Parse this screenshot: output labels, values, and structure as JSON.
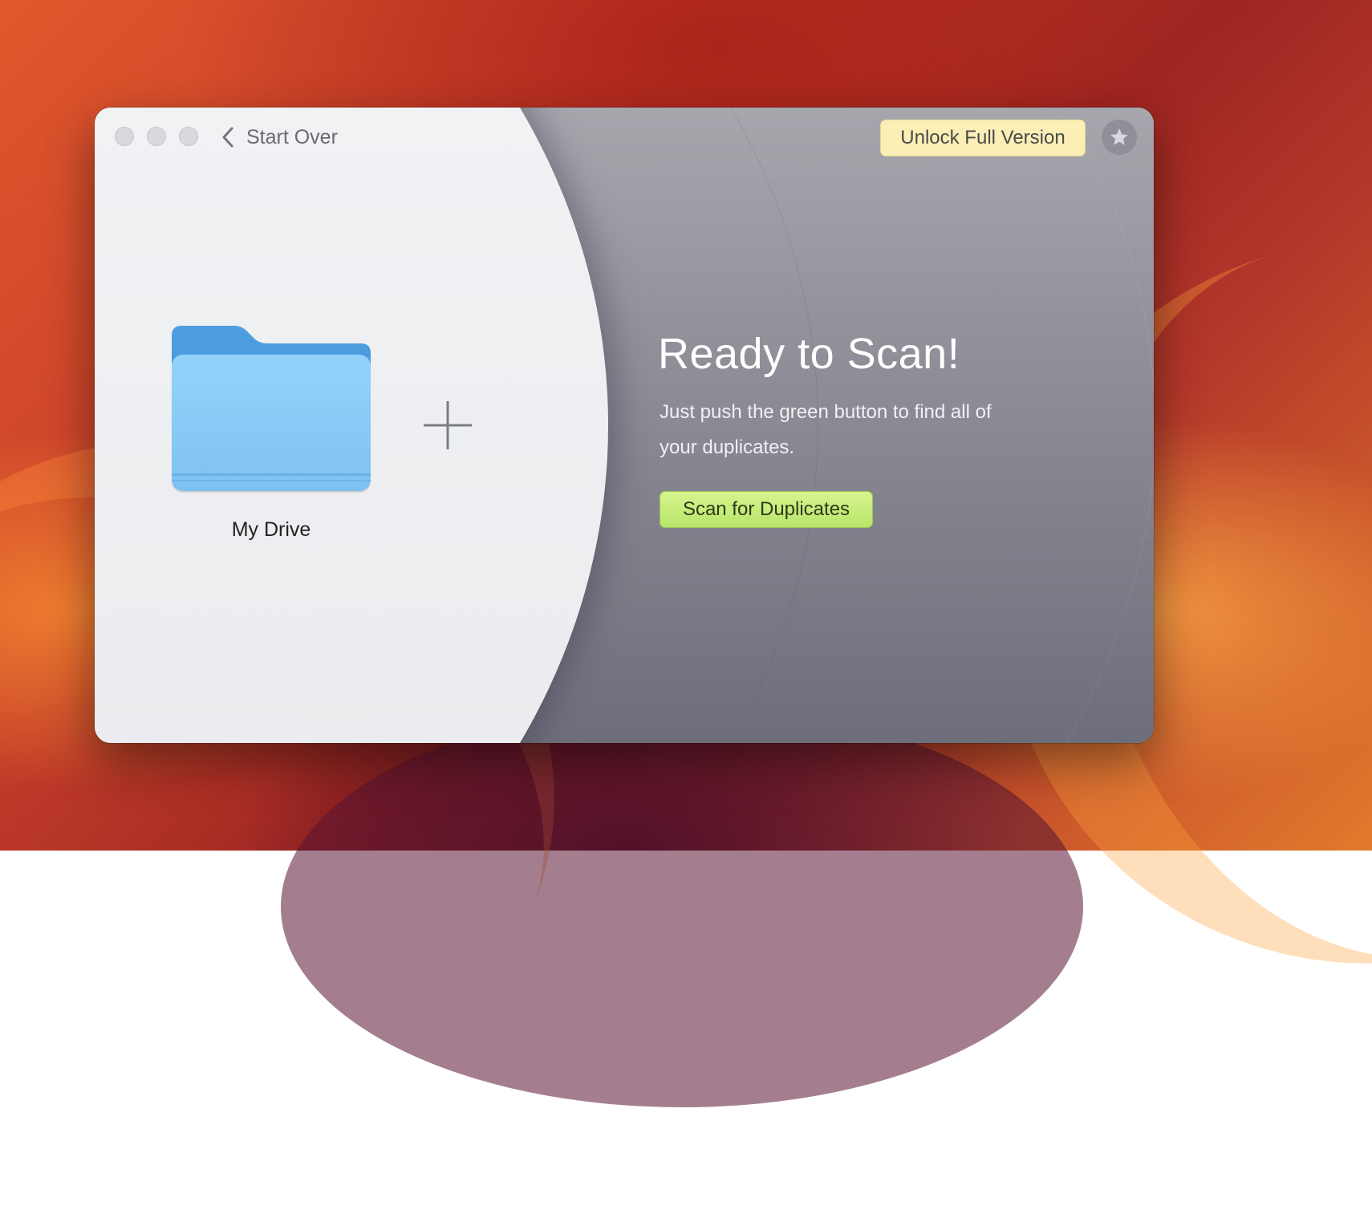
{
  "window": {
    "back_label": "Start Over",
    "unlock_label": "Unlock Full Version",
    "star_icon": "star-icon"
  },
  "left": {
    "folder_icon": "folder-icon",
    "folder_label": "My Drive",
    "add_icon": "plus-icon"
  },
  "right": {
    "headline": "Ready to Scan!",
    "subtext": "Just push the green button to find all of your duplicates.",
    "scan_label": "Scan for Duplicates"
  },
  "colors": {
    "unlock_bg": "#fbefb6",
    "scan_bg": "#c7ec78",
    "folder_blue": "#8ecdf7"
  }
}
